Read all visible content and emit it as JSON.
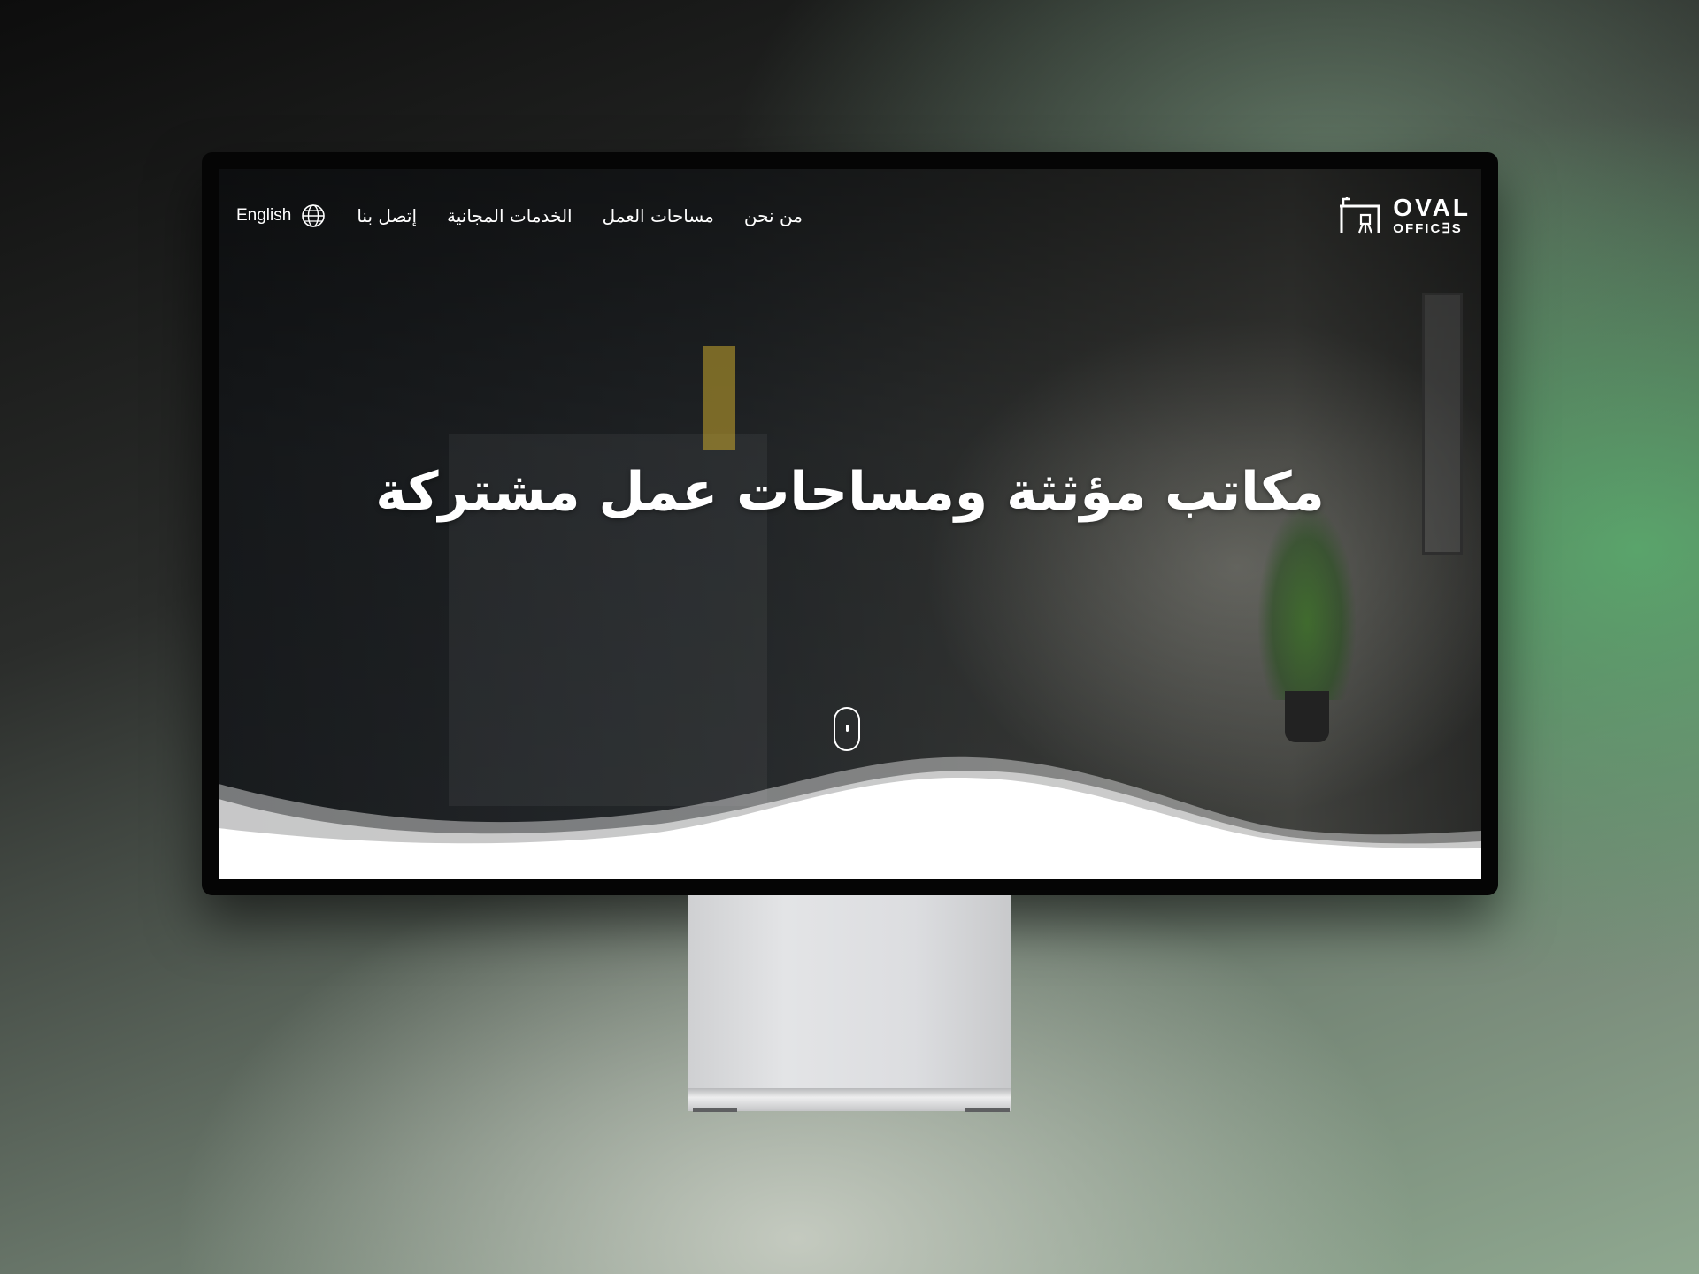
{
  "brand": {
    "name_line1": "OVAL",
    "name_line2": "OFFIC∃S"
  },
  "nav": {
    "items": [
      {
        "label": "من نحن"
      },
      {
        "label": "مساحات العمل"
      },
      {
        "label": "الخدمات المجانية"
      },
      {
        "label": "إتصل بنا"
      }
    ],
    "language_label": "English",
    "language_icon": "globe-icon"
  },
  "hero": {
    "title": "مكاتب مؤثثة ومساحات عمل مشتركة",
    "scroll_icon": "mouse-scroll-icon"
  },
  "colors": {
    "text": "#ffffff",
    "wave_front": "#ffffff",
    "wave_back": "#c9c9c9"
  }
}
